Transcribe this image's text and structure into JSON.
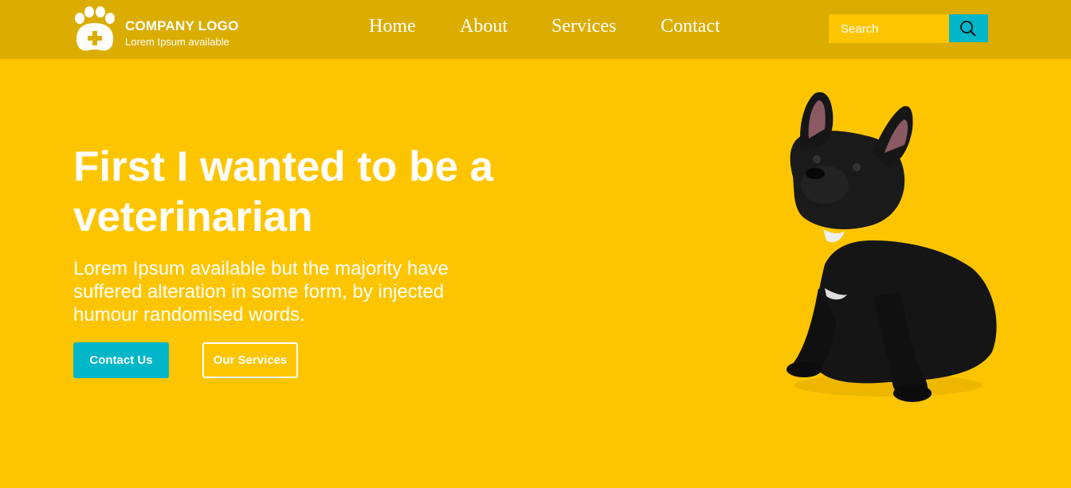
{
  "brand": {
    "name": "COMPANY LOGO",
    "tagline": "Lorem Ipsum available"
  },
  "nav": {
    "items": [
      {
        "label": "Home"
      },
      {
        "label": "About"
      },
      {
        "label": "Services"
      },
      {
        "label": "Contact"
      }
    ]
  },
  "search": {
    "placeholder": "Search"
  },
  "hero": {
    "title": "First I wanted to be a veterinarian",
    "text": "Lorem Ipsum available but the majority have suffered alteration in some form, by injected humour randomised words.",
    "primary_button": "Contact Us",
    "secondary_button": "Our Services",
    "image": "french-bulldog-photo"
  },
  "colors": {
    "background": "#fdc500",
    "header": "#dbad00",
    "accent": "#00b6c9",
    "text": "#ffffff"
  },
  "icons": [
    "paw-plus-icon",
    "search-icon"
  ]
}
